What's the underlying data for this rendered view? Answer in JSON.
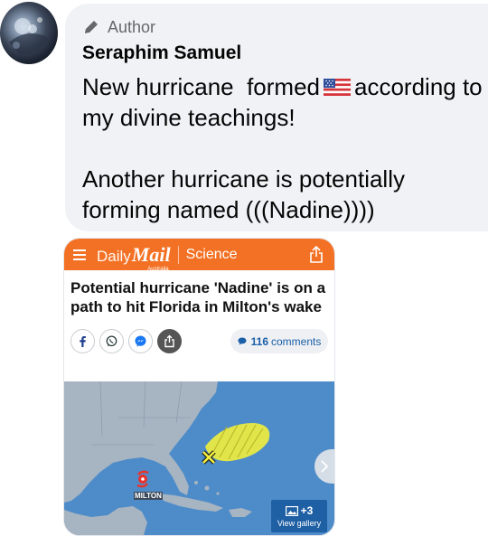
{
  "post": {
    "badge": "Author",
    "author_name": "Seraphim Samuel",
    "message_part1": "New hurricane  formed",
    "message_part2": "according to my divine teachings!\n\nAnother hurricane is potentially forming named (((Nadine))))",
    "flag_icon": "us-flag-emoji"
  },
  "article": {
    "site_daily": "Daily",
    "site_mail": "Mail",
    "site_region": "Australia",
    "section": "Science",
    "headline": "Potential hurricane 'Nadine' is on a path to hit Florida in Milton's wake",
    "comments_count": "116",
    "comments_label": "comments",
    "gallery_count": "+3",
    "gallery_label": "View gallery",
    "map_label": "MILTON",
    "colors": {
      "brand_orange": "#f37124",
      "link_blue": "#1a5fa8",
      "ocean": "#4d8cc9",
      "land": "#a7b4c2",
      "outlook_yellow": "#f2ee3c",
      "storm_red": "#e8322b"
    }
  }
}
